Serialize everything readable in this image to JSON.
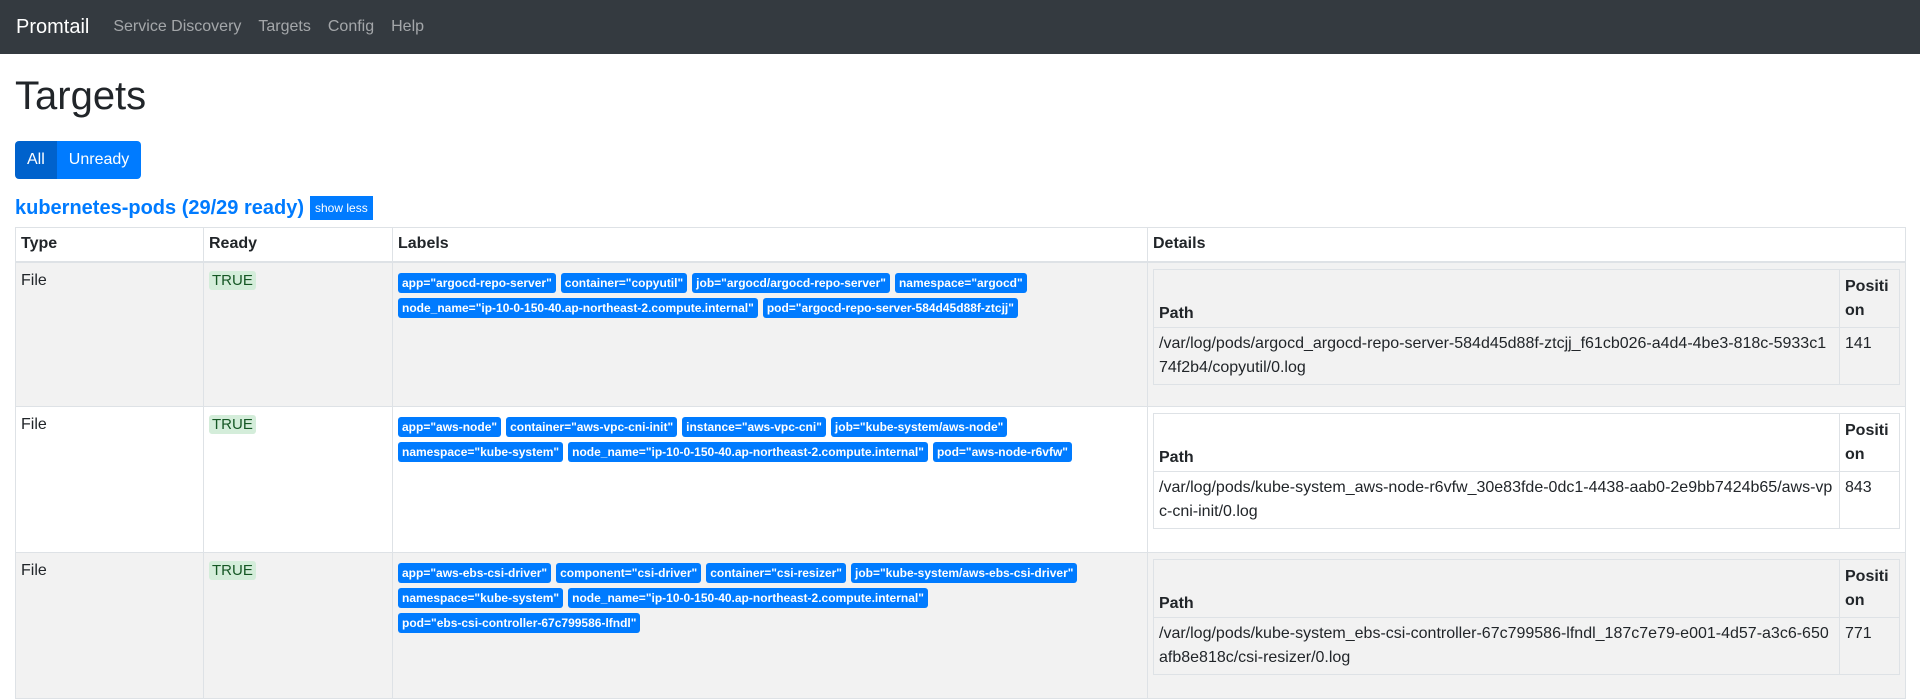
{
  "navbar": {
    "brand": "Promtail",
    "links": [
      "Service Discovery",
      "Targets",
      "Config",
      "Help"
    ]
  },
  "page": {
    "title": "Targets",
    "filters": {
      "all": "All",
      "unready": "Unready"
    }
  },
  "job": {
    "title": "kubernetes-pods (29/29 ready)",
    "toggle_label": "show less"
  },
  "table": {
    "headers": {
      "type": "Type",
      "ready": "Ready",
      "labels": "Labels",
      "details": "Details"
    },
    "detail_headers": {
      "path": "Path",
      "position": "Position"
    },
    "rows": [
      {
        "type": "File",
        "ready": "TRUE",
        "labels": [
          "app=\"argocd-repo-server\"",
          "container=\"copyutil\"",
          "job=\"argocd/argocd-repo-server\"",
          "namespace=\"argocd\"",
          "node_name=\"ip-10-0-150-40.ap-northeast-2.compute.internal\"",
          "pod=\"argocd-repo-server-584d45d88f-ztcjj\""
        ],
        "path": "/var/log/pods/argocd_argocd-repo-server-584d45d88f-ztcjj_f61cb026-a4d4-4be3-818c-5933c174f2b4/copyutil/0.log",
        "position": "141"
      },
      {
        "type": "File",
        "ready": "TRUE",
        "labels": [
          "app=\"aws-node\"",
          "container=\"aws-vpc-cni-init\"",
          "instance=\"aws-vpc-cni\"",
          "job=\"kube-system/aws-node\"",
          "namespace=\"kube-system\"",
          "node_name=\"ip-10-0-150-40.ap-northeast-2.compute.internal\"",
          "pod=\"aws-node-r6vfw\""
        ],
        "path": "/var/log/pods/kube-system_aws-node-r6vfw_30e83fde-0dc1-4438-aab0-2e9bb7424b65/aws-vpc-cni-init/0.log",
        "position": "843"
      },
      {
        "type": "File",
        "ready": "TRUE",
        "labels": [
          "app=\"aws-ebs-csi-driver\"",
          "component=\"csi-driver\"",
          "container=\"csi-resizer\"",
          "job=\"kube-system/aws-ebs-csi-driver\"",
          "namespace=\"kube-system\"",
          "node_name=\"ip-10-0-150-40.ap-northeast-2.compute.internal\"",
          "pod=\"ebs-csi-controller-67c799586-lfndl\""
        ],
        "path": "/var/log/pods/kube-system_ebs-csi-controller-67c799586-lfndl_187c7e79-e001-4d57-a3c6-650afb8e818c/csi-resizer/0.log",
        "position": "771"
      }
    ]
  }
}
